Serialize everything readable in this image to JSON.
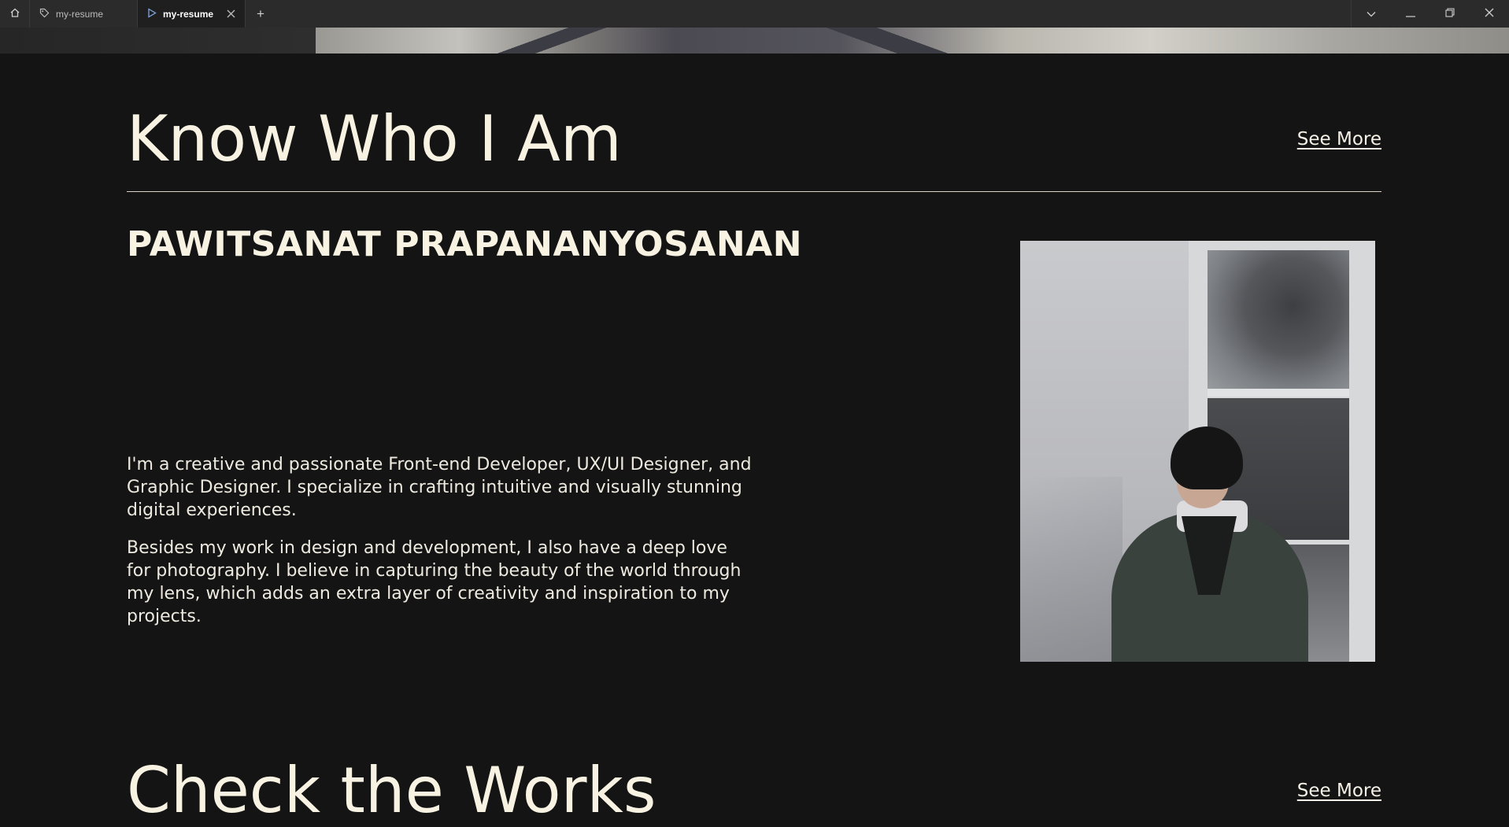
{
  "titlebar": {
    "tabs": [
      {
        "label": "my-resume",
        "active": false
      },
      {
        "label": "my-resume",
        "active": true
      }
    ],
    "new_tab": "+"
  },
  "about": {
    "title": "Know Who I Am",
    "see_more": "See More",
    "name": "PAWITSANAT PRAPANANYOSANAN",
    "bio_1": "I'm a creative and passionate Front-end Developer, UX/UI Designer, and Graphic Designer. I specialize in crafting intuitive and visually stunning digital experiences.",
    "bio_2": "Besides my work in design and development, I also have a deep love for photography. I believe in capturing the beauty of the world through my lens, which adds an extra layer of creativity and inspiration to my projects."
  },
  "works": {
    "title": "Check the Works",
    "see_more": "See More"
  },
  "colors": {
    "background": "#141414",
    "text": "#f7f2e2",
    "titlebar": "#2b2b2b"
  },
  "icons": {
    "home": "home-icon",
    "tab1": "tag-icon",
    "tab2": "play-icon",
    "close_tab": "close-icon",
    "dropdown": "chevron-down-icon",
    "minimize": "minimize-icon",
    "restore": "restore-icon",
    "close_window": "close-icon"
  }
}
